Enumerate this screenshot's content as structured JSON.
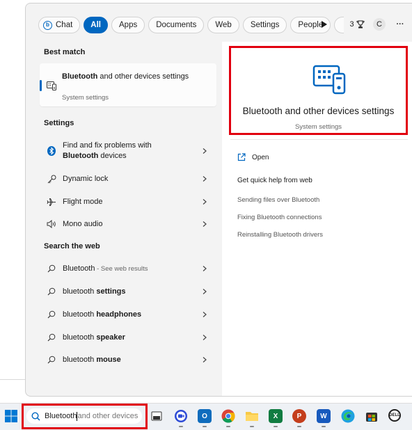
{
  "filters": {
    "chat": "Chat",
    "all": "All",
    "apps": "Apps",
    "documents": "Documents",
    "web": "Web",
    "settings": "Settings",
    "people": "People",
    "points": "3",
    "avatar": "C",
    "more": "···"
  },
  "left": {
    "best_match_heading": "Best match",
    "best_match": {
      "title_bold": "Bluetooth",
      "title_rest": " and other devices settings",
      "subtitle": "System settings"
    },
    "settings_heading": "Settings",
    "settings_items": [
      {
        "pre": "Find and fix problems with ",
        "bold": "Bluetooth",
        "post": " devices",
        "icon": "bluetooth-icon"
      },
      {
        "text": "Dynamic lock",
        "icon": "key-icon"
      },
      {
        "text": "Flight mode",
        "icon": "airplane-icon"
      },
      {
        "text": "Mono audio",
        "icon": "speaker-icon"
      }
    ],
    "web_heading": "Search the web",
    "web_items": [
      {
        "plain": "Bluetooth",
        "bold": "",
        "muted": " - See web results"
      },
      {
        "plain": "bluetooth ",
        "bold": "settings",
        "muted": ""
      },
      {
        "plain": "bluetooth ",
        "bold": "headphones",
        "muted": ""
      },
      {
        "plain": "bluetooth ",
        "bold": "speaker",
        "muted": ""
      },
      {
        "plain": "bluetooth ",
        "bold": "mouse",
        "muted": ""
      }
    ]
  },
  "right": {
    "card_title": "Bluetooth and other devices settings",
    "card_subtitle": "System settings",
    "open_label": "Open",
    "quick_help_heading": "Get quick help from web",
    "links": [
      "Sending files over Bluetooth",
      "Fixing Bluetooth connections",
      "Reinstalling Bluetooth drivers"
    ]
  },
  "taskbar": {
    "search_typed": "Bluetooth",
    "search_suggestion": " and other devices",
    "apps": [
      "start-icon",
      "task-view-icon",
      "zoom-icon",
      "outlook-icon",
      "chrome-icon",
      "file-explorer-icon",
      "excel-icon",
      "powerpoint-icon",
      "word-icon",
      "edge-icon",
      "store-icon",
      "dell-icon"
    ]
  },
  "colors": {
    "accent": "#0067c0",
    "highlight_border": "#e1000f"
  }
}
